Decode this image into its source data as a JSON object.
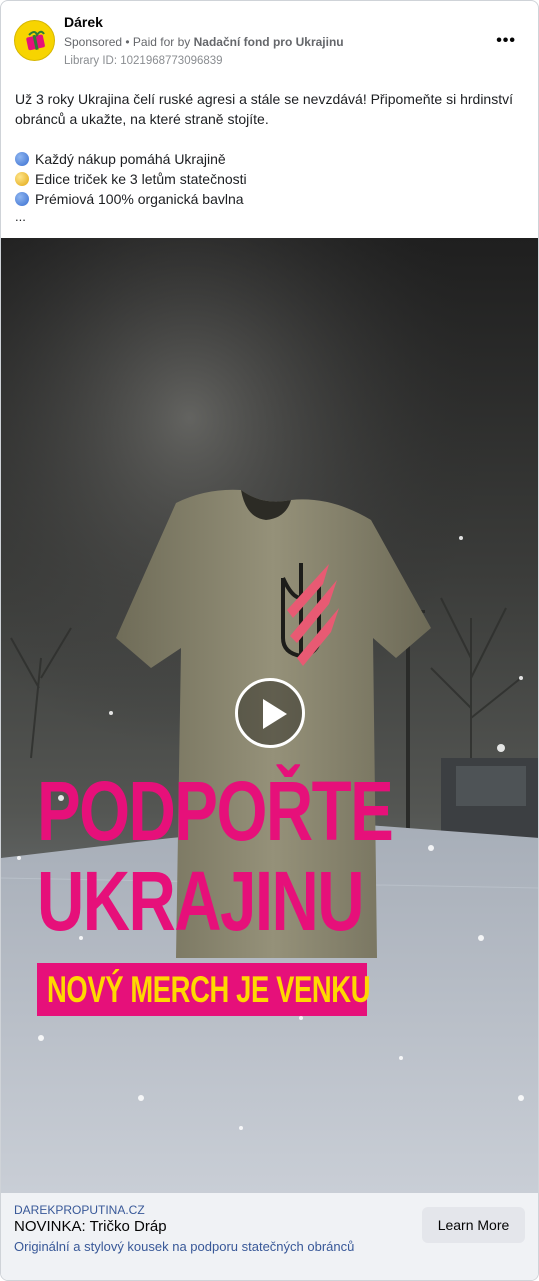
{
  "ad": {
    "page_name": "Dárek",
    "sponsored": "Sponsored",
    "paid_for_prefix": " • Paid for by ",
    "paid_for_org": "Nadační fond pro Ukrajinu",
    "library_id": "Library ID: 1021968773096839",
    "more_label": "•••"
  },
  "body": {
    "intro": "Už 3 roky Ukrajina čelí ruské agresi a stále se nevzdává! Připomeňte si hrdinství obránců a ukažte, na které straně stojíte.",
    "bullets": [
      {
        "icon": "blue-circle-icon",
        "text": "Každý nákup pomáhá Ukrajině"
      },
      {
        "icon": "yellow-circle-icon",
        "text": "Edice triček ke 3 letům statečnosti"
      },
      {
        "icon": "blue-circle-icon",
        "text": "Prémiová 100% organická bavlna"
      }
    ],
    "ellipsis": "..."
  },
  "media": {
    "headline_1": "PODPOŘTE",
    "headline_2": "UKRAJINU",
    "banner": "NOVÝ MERCH JE VENKU",
    "colors": {
      "headline": "#e6107a",
      "banner_bg": "#e6107a",
      "banner_text": "#ffd800",
      "shirt": "#8a8670"
    }
  },
  "footer": {
    "domain": "DAREKPROPUTINA.CZ",
    "title": "NOVINKA: Tričko Dráp",
    "description": "Originální a stylový kousek na podporu statečných obránců",
    "cta": "Learn More"
  }
}
